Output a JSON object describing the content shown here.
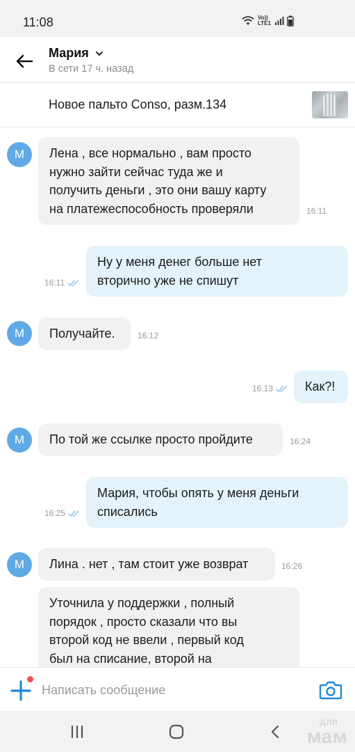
{
  "status_bar": {
    "time": "11:08",
    "lte_label": "Vo)) LTE1"
  },
  "header": {
    "contact_name": "Мария",
    "contact_status": "В сети 17 ч. назад"
  },
  "product": {
    "title": "Новое пальто Conso, разм.134"
  },
  "avatar_letter": "M",
  "messages": [
    {
      "direction": "in",
      "lines": [
        "Лена , все нормально , вам просто",
        "нужно зайти сейчас туда же и",
        "получить деньги , это они вашу карту",
        "на платежеспособность проверяли"
      ],
      "time": "16:11"
    },
    {
      "direction": "out",
      "lines": [
        "Ну у меня денег больше нет",
        "вторично уже не спишут"
      ],
      "time": "16:11",
      "read": true
    },
    {
      "direction": "in",
      "lines": [
        "Получайте."
      ],
      "time": "16:12"
    },
    {
      "direction": "out",
      "lines": [
        "Как?!"
      ],
      "time": "16:13",
      "read": true
    },
    {
      "direction": "in",
      "lines": [
        "По той же ссылке просто пройдите"
      ],
      "time": "16:24"
    },
    {
      "direction": "out",
      "lines": [
        "Мария, чтобы опять у меня деньги",
        "списались"
      ],
      "time": "16:25",
      "read": true
    },
    {
      "direction": "in",
      "lines": [
        "Лина . нет , там стоит уже возврат"
      ],
      "time": "16:26"
    },
    {
      "direction": "in",
      "lines": [
        "Уточнила у поддержки , полный",
        "порядок , просто сказали что вы",
        "второй код не ввели , первый код",
        "был на списание, второй на"
      ],
      "time": ""
    }
  ],
  "composer": {
    "placeholder": "Написать сообщение"
  },
  "watermark": {
    "line1": "для",
    "line2": "мам"
  },
  "colors": {
    "avatar": "#5fa9e6",
    "incoming_bubble": "#f1f1f1",
    "outgoing_bubble": "#e3f2fb",
    "accent": "#1e88d8",
    "badge": "#f0524f"
  }
}
